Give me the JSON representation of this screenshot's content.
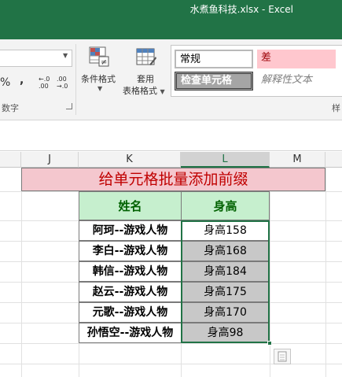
{
  "window": {
    "title": "水煮鱼科技.xlsx  -  Excel"
  },
  "ribbon": {
    "number_group": {
      "format_value": "",
      "percent_symbol": "%",
      "comma_symbol": ",",
      "increase_decimal": "←.0 .00",
      "decrease_decimal": ".00 →.0",
      "label": "数字"
    },
    "conditional_formatting": {
      "label": "条件格式"
    },
    "format_as_table": {
      "label_line1": "套用",
      "label_line2": "表格格式"
    },
    "cell_styles": {
      "items": [
        "常规",
        "差",
        "检查单元格",
        "解释性文本"
      ],
      "group_label": "样"
    },
    "icons": {
      "dropdown": "chevron-down-icon",
      "conditional_formatting": "conditional-formatting-icon",
      "format_as_table": "format-as-table-icon",
      "launcher": "dialog-launcher-icon"
    }
  },
  "sheet": {
    "columns": [
      "J",
      "K",
      "L",
      "M"
    ],
    "active_column": "L",
    "banner": "给单元格批量添加前缀",
    "table": {
      "headers": [
        "姓名",
        "身高"
      ],
      "rows": [
        [
          "阿珂--游戏人物",
          "身高158"
        ],
        [
          "李白--游戏人物",
          "身高168"
        ],
        [
          "韩信--游戏人物",
          "身高184"
        ],
        [
          "赵云--游戏人物",
          "身高175"
        ],
        [
          "元歌--游戏人物",
          "身高170"
        ],
        [
          "孙悟空--游戏人物",
          "身高98"
        ]
      ]
    },
    "colors": {
      "excel_green": "#217346",
      "banner_fill": "#f4c7ce",
      "banner_text": "#c00000",
      "header_fill": "#c6efce",
      "header_text": "#006100",
      "selected_fill": "#c8c8c8"
    }
  }
}
